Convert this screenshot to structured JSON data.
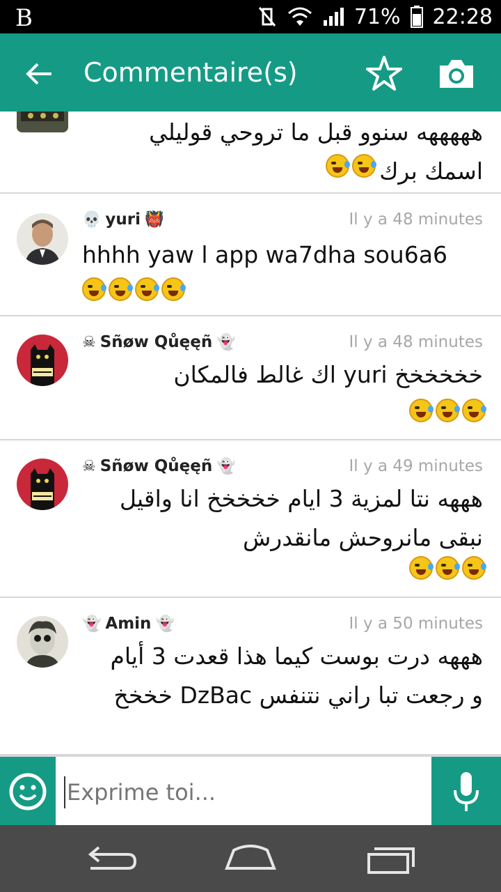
{
  "status_bar": {
    "logo": "B",
    "battery": "71%",
    "time": "22:28"
  },
  "app_bar": {
    "title": "Commentaire(s)",
    "back_icon": "arrow-back-icon",
    "star_icon": "star-outline-icon",
    "camera_icon": "camera-icon"
  },
  "comments": [
    {
      "username": "",
      "timestamp": "",
      "text": "هههههه سنوو قبل ما تروحي قوليلي اسمك برك",
      "direction": "rtl",
      "emojis": 2
    },
    {
      "username": "yuri",
      "user_icon_left": "💀",
      "user_icon_right": "👹",
      "timestamp": "Il y a 48 minutes",
      "text": "hhhh yaw l app wa7dha sou6a6",
      "direction": "ltr",
      "emojis": 4
    },
    {
      "username": "Sñøw Qůęęñ",
      "user_icon_left": "☠",
      "user_icon_right": "👻",
      "timestamp": "Il y a 48 minutes",
      "text": "خخخخخخ yuri اك غالط فالمكان",
      "direction": "rtl",
      "emojis": 3
    },
    {
      "username": "Sñøw Qůęęñ",
      "user_icon_left": "☠",
      "user_icon_right": "👻",
      "timestamp": "Il y a 49 minutes",
      "text": "هههه نتا لمزية 3 ايام خخخخخ انا واقيل نبقى مانروحش مانقدرش",
      "direction": "rtl",
      "emojis": 3
    },
    {
      "username": "Amin",
      "user_icon_left": "👻",
      "user_icon_right": "👻",
      "timestamp": "Il y a 50 minutes",
      "text": "هههه درت بوست كيما هذا قعدت 3 أيام و رجعت تبا راني نتنفس DzBac خخخخ",
      "direction": "rtl",
      "emojis": 0
    }
  ],
  "input": {
    "placeholder": "Exprime toi..."
  },
  "colors": {
    "primary": "#159b85",
    "status_bar": "#000000",
    "nav_bar": "#4a4a4a",
    "timestamp": "#a7a7a7"
  }
}
